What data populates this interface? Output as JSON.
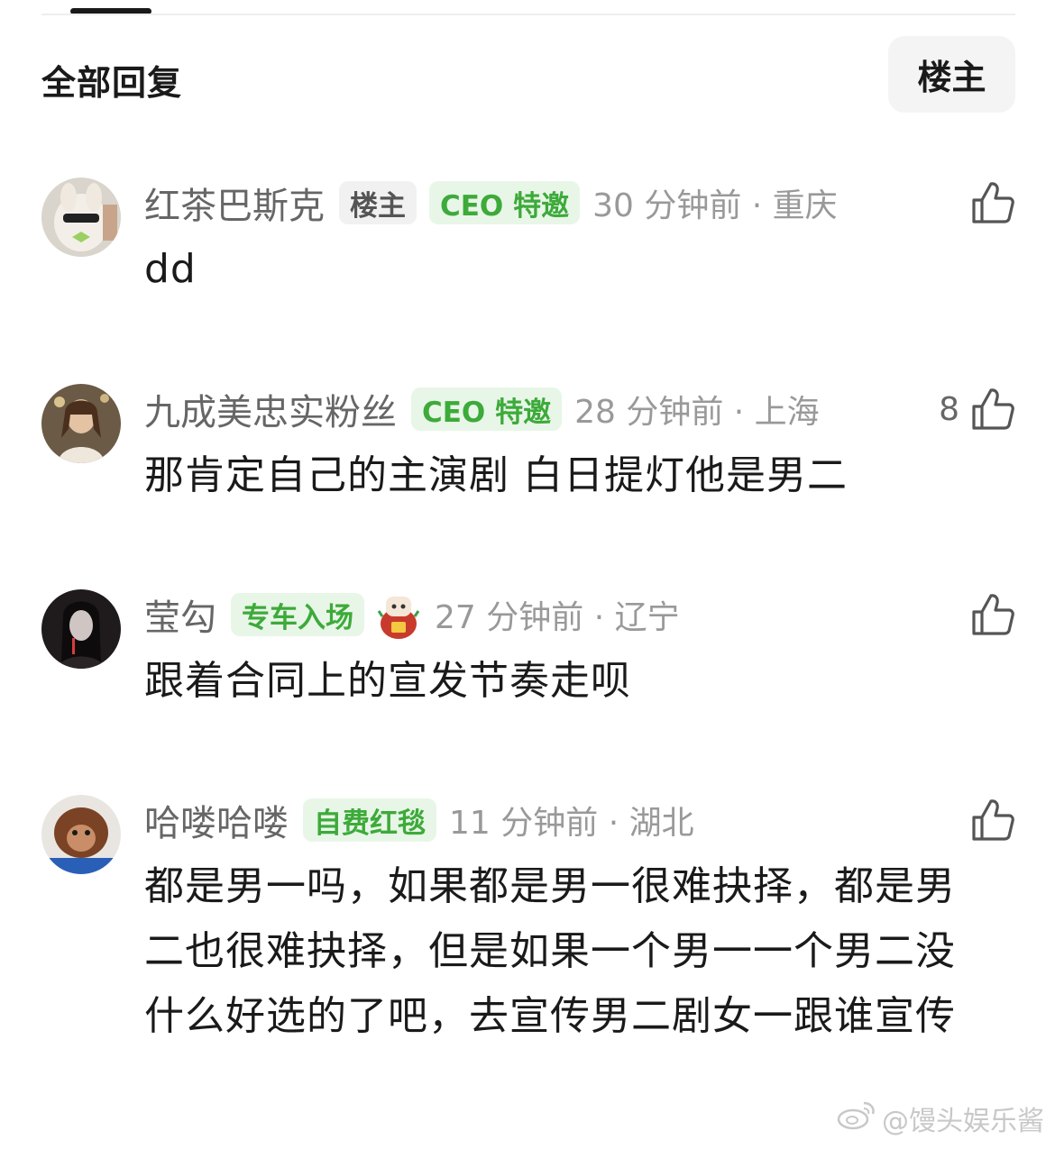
{
  "header": {
    "title": "全部回复",
    "filter_label": "楼主"
  },
  "comments": [
    {
      "username": "红茶巴斯克",
      "badges": [
        "楼主",
        "CEO 特邀"
      ],
      "time": "30 分钟前 · 重庆",
      "like_count": "",
      "text": "dd"
    },
    {
      "username": "九成美忠实粉丝",
      "badges": [
        "CEO 特邀"
      ],
      "time": "28 分钟前 · 上海",
      "like_count": "8",
      "text": "那肯定自己的主演剧 白日提灯他是男二"
    },
    {
      "username": "莹勾",
      "badges": [
        "专车入场"
      ],
      "time": "27 分钟前 · 辽宁",
      "like_count": "",
      "text": "跟着合同上的宣发节奏走呗"
    },
    {
      "username": "哈喽哈喽",
      "badges": [
        "自费红毯"
      ],
      "time": "11 分钟前 · 湖北",
      "like_count": "",
      "text": "都是男一吗，如果都是男一很难抉择，都是男二也很难抉择，但是如果一个男一一个男二没什么好选的了吧，去宣传男二剧女一跟谁宣传"
    }
  ],
  "watermark": "@馒头娱乐酱",
  "colors": {
    "badge_green_bg": "#e8f6e8",
    "badge_green_text": "#3daa3a",
    "badge_op_bg": "#f1f1f1",
    "meta_text": "#999999"
  },
  "icons": {
    "like": "thumbs-up-icon",
    "watermark": "weibo-logo-icon"
  }
}
